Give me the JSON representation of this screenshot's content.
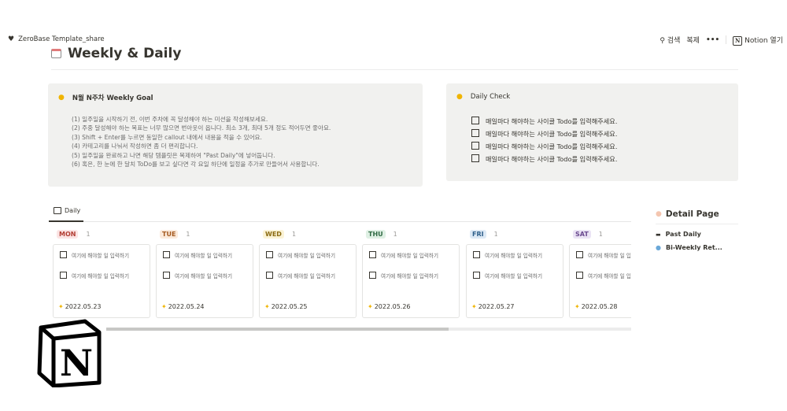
{
  "breadcrumb": {
    "workspace": "ZeroBase Template_share"
  },
  "topbar": {
    "search": "검색",
    "duplicate": "복제",
    "more": "•••",
    "open_notion": "Notion 열기"
  },
  "page": {
    "title": "Weekly & Daily"
  },
  "goal_callout": {
    "title": "N월 N주차 Weekly Goal",
    "lines": [
      "(1) 일주일을 시작하기 전, 이번 주차에 꼭 달성해야 하는 미션을 작성해보세요.",
      "(2) 주중 달성해야 하는 목표는 너무 많으면 번아웃이 옵니다. 최소 3개, 최대 5개 정도 적어두면 좋아요.",
      "(3) Shift + Enter를 누르면 동일한 callout 내에서 내용을 적을 수 있어요.",
      "(4) 카테고리를 나눠서 작성하면 좀 더 편리합니다.",
      "(5) 일주일을 완료하고 나면 해당 템플릿은 복제하여 \"Past Daily\"에 넣어둡니다.",
      "(6) 혹은, 한 눈에 한 달치 ToDo를 보고 싶다면 각 요일 하단에 일정을 추가로 만들어서 사용합니다."
    ]
  },
  "daily_check": {
    "title": "Daily Check",
    "items": [
      "매일마다 해야하는 사이클 Todo를 입력해주세요.",
      "매일마다 해야하는 사이클 Todo를 입력해주세요.",
      "매일마다 해야하는 사이클 Todo를 입력해주세요.",
      "매일마다 해야하는 사이클 Todo를 입력해주세요."
    ]
  },
  "board": {
    "tab": "Daily",
    "columns": [
      {
        "day": "MON",
        "count": "1",
        "todo1": "여기에 해야할 일 입력하기",
        "todo2": "여기에 해야할 일 입력하기",
        "date": "2022.05.23",
        "bg": "#fbe4e4",
        "fg": "#b23d33"
      },
      {
        "day": "TUE",
        "count": "1",
        "todo1": "여기에 해야할 일 입력하기",
        "todo2": "여기에 해야할 일 입력하기",
        "date": "2022.05.24",
        "bg": "#fbeadb",
        "fg": "#a55a1f"
      },
      {
        "day": "WED",
        "count": "1",
        "todo1": "여기에 해야할 일 입력하기",
        "todo2": "여기에 해야할 일 입력하기",
        "date": "2022.05.25",
        "bg": "#fbf3d6",
        "fg": "#8a6a10"
      },
      {
        "day": "THU",
        "count": "1",
        "todo1": "여기에 해야할 일 입력하기",
        "todo2": "여기에 해야할 일 입력하기",
        "date": "2022.05.26",
        "bg": "#dff0e4",
        "fg": "#2f6a43"
      },
      {
        "day": "FRI",
        "count": "1",
        "todo1": "여기에 해야할 일 입력하기",
        "todo2": "여기에 해야할 일 입력하기",
        "date": "2022.05.27",
        "bg": "#dde9f5",
        "fg": "#2d5f8a"
      },
      {
        "day": "SAT",
        "count": "1",
        "todo1": "여기에 해야할 일 입력하기",
        "todo2": "여기에 해야할 일 입력하기",
        "date": "2022.05.28",
        "bg": "#ebe4f5",
        "fg": "#6a4a8f"
      }
    ]
  },
  "detail_page": {
    "title": "Detail Page",
    "items": [
      "Past Daily",
      "Bi-Weekly Ret..."
    ]
  },
  "icons": {
    "heart": "heart-icon",
    "search": "search-icon",
    "calendar": "calendar-icon",
    "bulb": "lightbulb-icon",
    "star": "sparkle-icon",
    "logo": "notion-logo"
  }
}
